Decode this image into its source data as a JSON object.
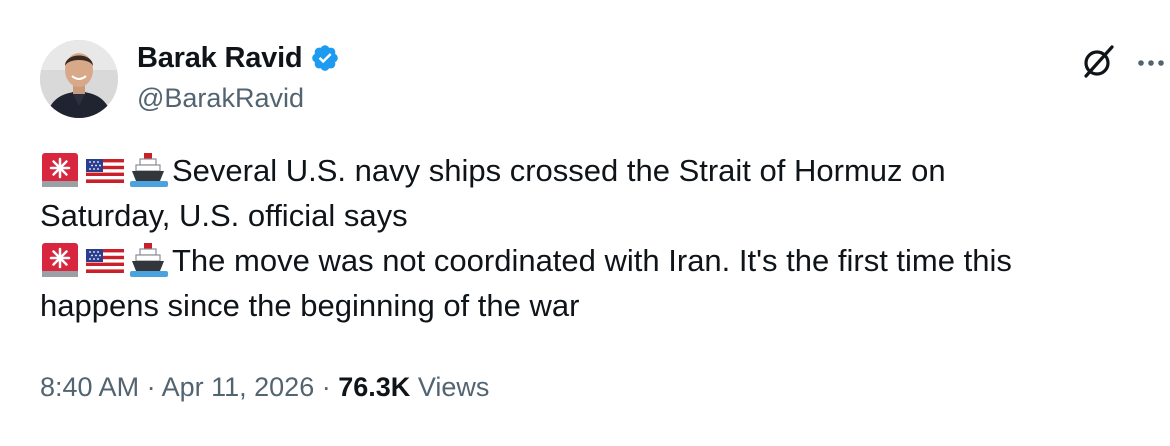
{
  "author": {
    "display_name": "Barak Ravid",
    "handle": "@BarakRavid",
    "verified": true,
    "verified_color": "#1d9bf0"
  },
  "icons": {
    "verified": "verified-badge-icon",
    "grok": "grok-slash-circle-icon",
    "more": "more-horizontal-icon",
    "emoji_sequence": [
      "rotating-light-emoji",
      "us-flag-emoji",
      "ship-emoji"
    ]
  },
  "tweet": {
    "line1_text": "Several U.S. navy ships crossed the Strait of Hormuz on",
    "line2_text": "Saturday, U.S. official says",
    "line3_text": "The move was not coordinated with Iran. It's the first time this",
    "line4_text": "happens since the beginning of the war"
  },
  "meta": {
    "time": "8:40 AM",
    "separator": "·",
    "date": "Apr 11, 2026",
    "views_count": "76.3K",
    "views_label": "Views"
  },
  "colors": {
    "text_primary": "#0f1419",
    "text_secondary": "#536471",
    "background": "#ffffff"
  }
}
